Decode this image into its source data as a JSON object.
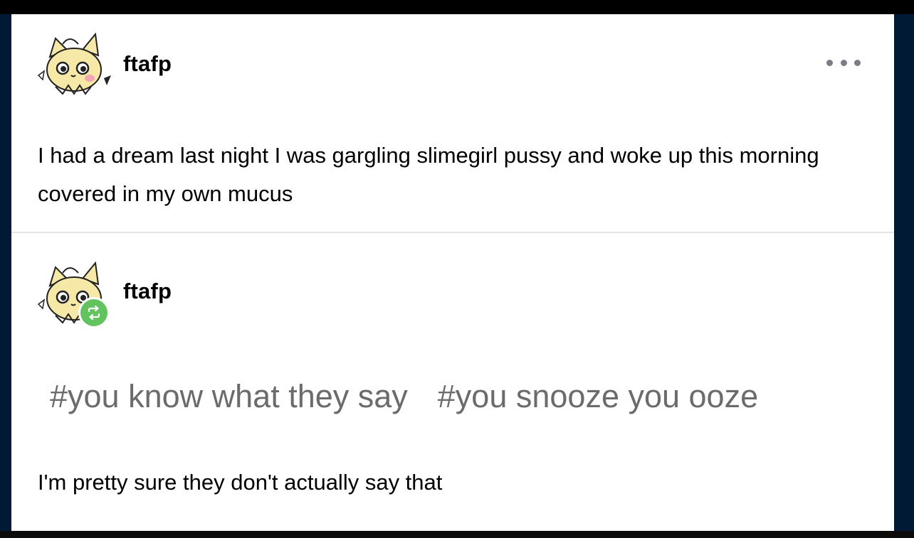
{
  "post": {
    "author": {
      "username": "ftafp",
      "avatar": "cat-creature-avatar"
    },
    "body": "I had a dream last night I was gargling slimegirl pussy and woke up this morning covered in my own mucus",
    "more_icon": "ellipsis-horizontal-icon"
  },
  "reblog": {
    "author": {
      "username": "ftafp",
      "avatar": "cat-creature-avatar",
      "badge_icon": "reblog-icon"
    },
    "tags": [
      "#you know what they say",
      "#you snooze you ooze"
    ],
    "body": "I'm pretty sure they don't actually say that"
  },
  "colors": {
    "background": "#001935",
    "card": "#ffffff",
    "tag_text": "#6b6b6b",
    "reblog_badge": "#63c35e",
    "more_dots": "#7a7d85",
    "divider": "#e4e4e4"
  }
}
